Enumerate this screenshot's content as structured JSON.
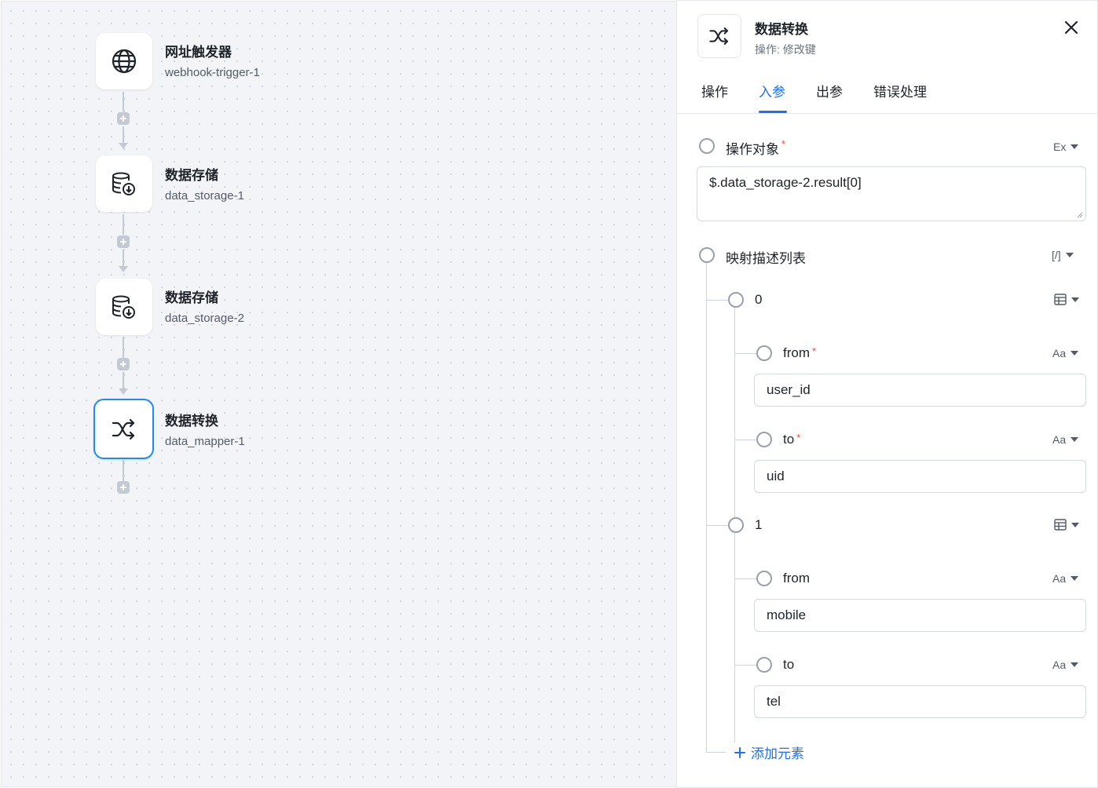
{
  "flow": {
    "nodes": [
      {
        "title": "网址触发器",
        "id": "webhook-trigger-1",
        "icon": "globe-icon"
      },
      {
        "title": "数据存储",
        "id": "data_storage-1",
        "icon": "database-download-icon"
      },
      {
        "title": "数据存储",
        "id": "data_storage-2",
        "icon": "database-download-icon"
      },
      {
        "title": "数据转换",
        "id": "data_mapper-1",
        "icon": "shuffle-icon",
        "selected": true
      }
    ]
  },
  "panel": {
    "title": "数据转换",
    "subtitle": "操作: 修改键",
    "tabs": [
      "操作",
      "入参",
      "出参",
      "错误处理"
    ],
    "active_tab": "入参",
    "target": {
      "label": "操作对象",
      "required_mark": "*",
      "type": "Ex",
      "value": "$.data_storage-2.result[0]"
    },
    "mapping": {
      "label": "映射描述列表",
      "type": "[/]",
      "items": [
        {
          "index": "0",
          "from": {
            "label": "from",
            "required_mark": "*",
            "type": "Aa",
            "value": "user_id"
          },
          "to": {
            "label": "to",
            "required_mark": "*",
            "type": "Aa",
            "value": "uid"
          }
        },
        {
          "index": "1",
          "from": {
            "label": "from",
            "type": "Aa",
            "value": "mobile"
          },
          "to": {
            "label": "to",
            "type": "Aa",
            "value": "tel"
          }
        }
      ],
      "add_label": "添加元素"
    }
  },
  "colors": {
    "accent": "#1e6ff5",
    "selected_border": "#1e8cf5",
    "required": "#f5483b"
  }
}
